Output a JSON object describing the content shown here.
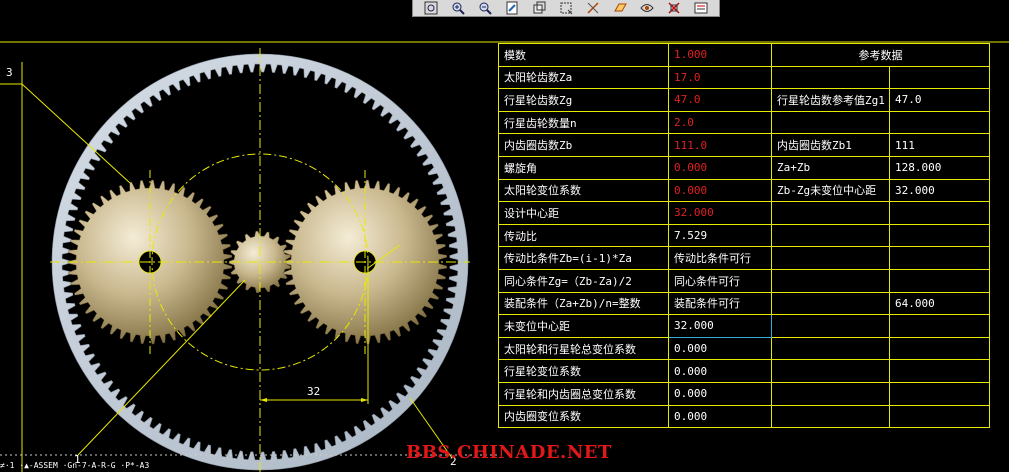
{
  "status_line": "≠·1    ·▲-ASSEM  ·Gn-7-A-R-G  ·P*-A3",
  "watermark": "BBS.CHINADE.NET",
  "labels": {
    "callout_3": "3",
    "callout_1": "1",
    "callout_2": "2",
    "dim_32": "32"
  },
  "table": {
    "header": "参考数据",
    "rows": [
      {
        "label": "模数",
        "value": "1.000",
        "red": true
      },
      {
        "label": "太阳轮齿数Za",
        "value": "17.0",
        "red": true
      },
      {
        "label": "行星轮齿数Zg",
        "value": "47.0",
        "red": true,
        "ref_label": "行星轮齿数参考值Zg1",
        "ref_value": "47.0"
      },
      {
        "label": "行星齿轮数量n",
        "value": "2.0",
        "red": true
      },
      {
        "label": "内齿圈齿数Zb",
        "value": "111.0",
        "red": true,
        "ref_label": "内齿圈齿数Zb1",
        "ref_value": "111"
      },
      {
        "label": "螺旋角",
        "value": "0.000",
        "red": true,
        "ref_label": "Za+Zb",
        "ref_value": "128.000"
      },
      {
        "label": "太阳轮变位系数",
        "value": "0.000",
        "red": true,
        "ref_label": "Zb-Zg未变位中心距",
        "ref_value": "32.000"
      },
      {
        "label": "设计中心距",
        "value": "32.000",
        "red": true
      },
      {
        "label": "传动比",
        "value": "7.529"
      },
      {
        "label": "传动比条件Zb=(i-1)*Za",
        "value": "传动比条件可行"
      },
      {
        "label": "同心条件Zg=（Zb-Za)/2",
        "value": "同心条件可行"
      },
      {
        "label": "装配条件（Za+Zb)/n=整数",
        "value": "装配条件可行",
        "ref_value": "64.000"
      },
      {
        "label": "未变位中心距",
        "value": "32.000",
        "highlight": true
      },
      {
        "label": "太阳轮和行星轮总变位系数",
        "value": "0.000"
      },
      {
        "label": "行星轮变位系数",
        "value": "0.000"
      },
      {
        "label": "行星轮和内齿圈总变位系数",
        "value": "0.000"
      },
      {
        "label": "内齿圈变位系数",
        "value": "0.000"
      }
    ]
  },
  "toolbar": [
    {
      "icon": "zoom-fit-icon"
    },
    {
      "icon": "zoom-in-icon"
    },
    {
      "icon": "zoom-out-icon"
    },
    {
      "icon": "redraw-icon"
    },
    {
      "icon": "orient-icon"
    },
    {
      "icon": "view-icon"
    },
    {
      "icon": "datum-axis-icon"
    },
    {
      "icon": "datum-plane-icon"
    },
    {
      "icon": "datum-point-icon"
    },
    {
      "icon": "coord-sys-icon"
    },
    {
      "icon": "annotation-icon"
    }
  ],
  "colors": {
    "yellow": "#e8e800",
    "ring": "#c5d0dc",
    "gear": "#c4b083",
    "red": "#e02020",
    "highlight": "#3ab0d8"
  }
}
